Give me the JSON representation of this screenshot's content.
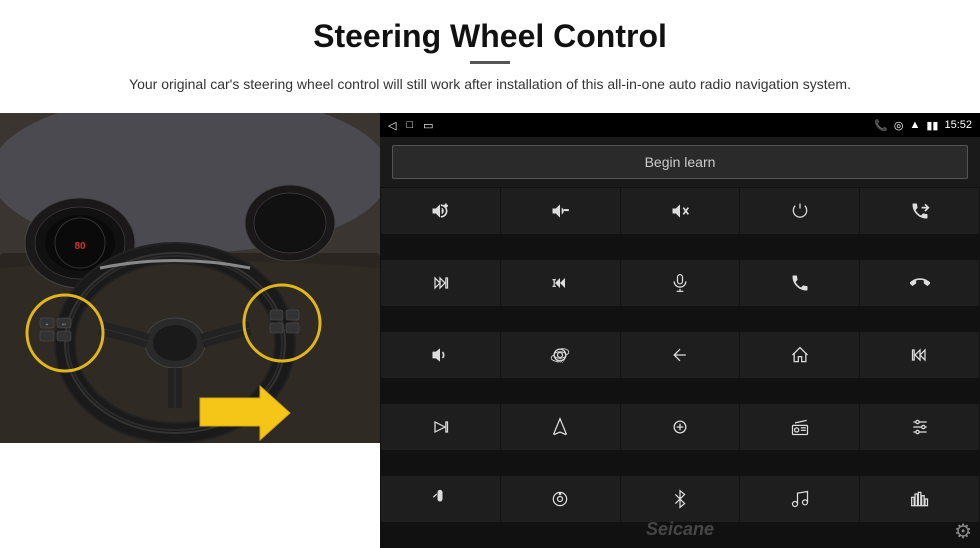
{
  "header": {
    "title": "Steering Wheel Control",
    "subtitle": "Your original car's steering wheel control will still work after installation of this all-in-one auto radio navigation system.",
    "divider": true
  },
  "status_bar": {
    "time": "15:52",
    "back_icon": "◁",
    "home_icon": "□",
    "recents_icon": "▭"
  },
  "begin_learn_button": {
    "label": "Begin learn"
  },
  "controls": [
    {
      "id": "vol-up",
      "icon": "vol_up"
    },
    {
      "id": "vol-down",
      "icon": "vol_down"
    },
    {
      "id": "mute",
      "icon": "mute"
    },
    {
      "id": "power",
      "icon": "power"
    },
    {
      "id": "prev-call",
      "icon": "prev_call"
    },
    {
      "id": "skip-fwd",
      "icon": "skip_fwd"
    },
    {
      "id": "rew-ff",
      "icon": "rew_ff"
    },
    {
      "id": "mic",
      "icon": "mic"
    },
    {
      "id": "phone",
      "icon": "phone"
    },
    {
      "id": "hang-up",
      "icon": "hang_up"
    },
    {
      "id": "speaker",
      "icon": "speaker"
    },
    {
      "id": "camera360",
      "icon": "camera360"
    },
    {
      "id": "back",
      "icon": "back_arrow"
    },
    {
      "id": "home",
      "icon": "home"
    },
    {
      "id": "prev-track",
      "icon": "prev_track"
    },
    {
      "id": "next-track",
      "icon": "next_track"
    },
    {
      "id": "nav",
      "icon": "navigation"
    },
    {
      "id": "eq",
      "icon": "eq"
    },
    {
      "id": "radio",
      "icon": "radio"
    },
    {
      "id": "settings-ctrl",
      "icon": "settings_ctrl"
    },
    {
      "id": "mic2",
      "icon": "mic2"
    },
    {
      "id": "knob",
      "icon": "knob"
    },
    {
      "id": "bluetooth",
      "icon": "bluetooth"
    },
    {
      "id": "music",
      "icon": "music"
    },
    {
      "id": "equalizer",
      "icon": "equalizer"
    }
  ],
  "watermark": "Seicane",
  "gear_icon": "⚙"
}
